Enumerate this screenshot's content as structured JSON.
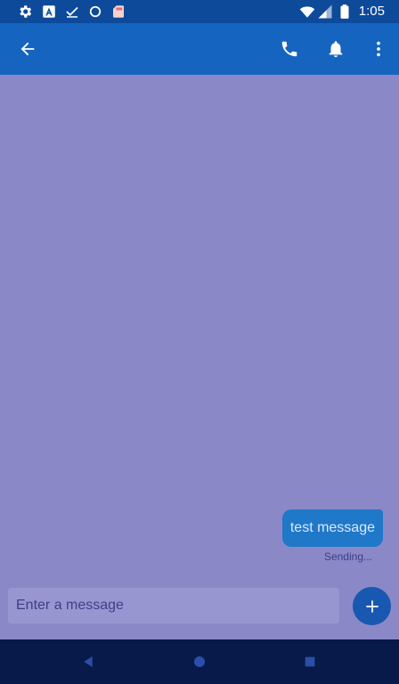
{
  "status_bar": {
    "time": "1:05",
    "left_icons": [
      "gear-icon",
      "font-a-icon",
      "download-done-icon",
      "circle-icon",
      "sd-card-icon"
    ],
    "right_icons": [
      "wifi-icon",
      "signal-icon",
      "battery-icon"
    ]
  },
  "app_bar": {
    "back_icon": "arrow-back-icon",
    "actions": [
      "phone-icon",
      "bell-icon",
      "more-vert-icon"
    ]
  },
  "conversation": {
    "messages": [
      {
        "text": "test message",
        "status": "Sending..."
      }
    ]
  },
  "composer": {
    "placeholder": "Enter a message",
    "send_icon": "plus-icon"
  },
  "nav_bar": {
    "buttons": [
      "back-triangle-icon",
      "home-circle-icon",
      "recents-square-icon"
    ]
  },
  "colors": {
    "status_bar": "#0d4a9a",
    "app_bar": "#1565c0",
    "background": "#8b88c8",
    "bubble": "#1f78c8",
    "fab": "#1858b0",
    "nav_bar": "#081a4a"
  }
}
